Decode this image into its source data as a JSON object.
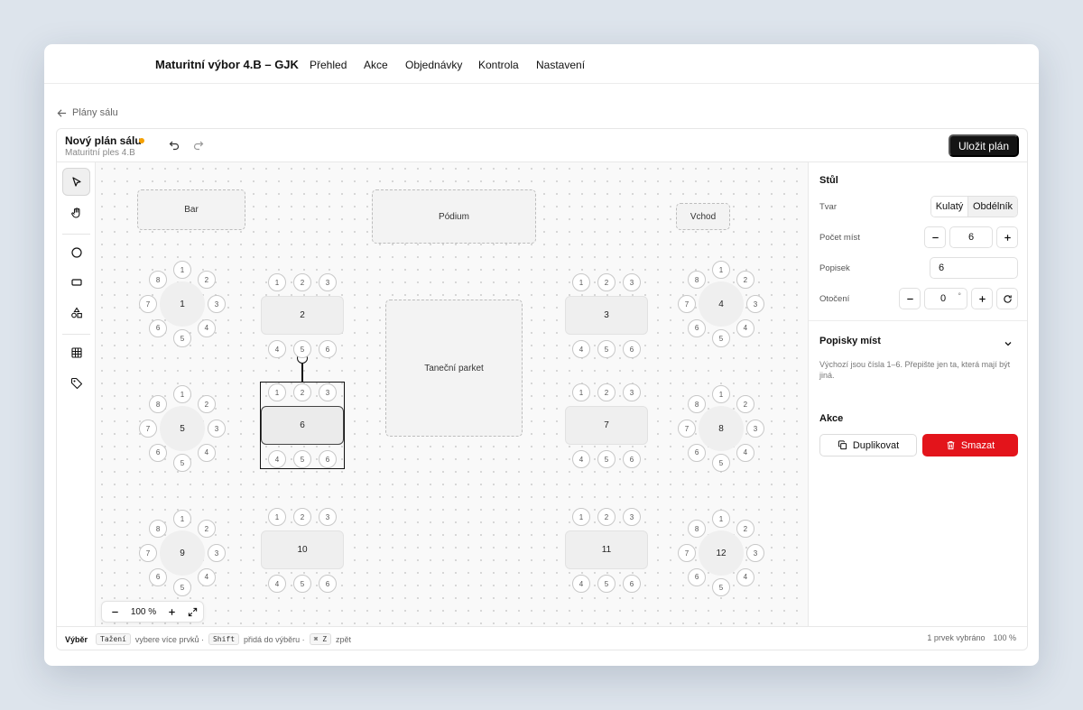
{
  "nav": {
    "brand": "Maturitní výbor 4.B – GJK",
    "links": [
      "Přehled",
      "Akce",
      "Objednávky",
      "Kontrola",
      "Nastavení"
    ]
  },
  "back": {
    "label": "Plány sálu"
  },
  "editor": {
    "title": "Nový plán sálu",
    "subtitle": "Maturitní ples 4.B",
    "save_label": "Uložit plán",
    "tools": [
      "select-tool",
      "hand-tool",
      "circle-tool",
      "rectangle-tool",
      "shapes-tool",
      "grid-tool",
      "tag-tool"
    ]
  },
  "canvas": {
    "zones": [
      {
        "id": "bar",
        "label": "Bar"
      },
      {
        "id": "podium",
        "label": "Pódium"
      },
      {
        "id": "vchod",
        "label": "Vchod"
      },
      {
        "id": "parket",
        "label": "Taneční parket"
      }
    ],
    "tables": [
      {
        "label": "1",
        "shape": "round",
        "seats": 8
      },
      {
        "label": "2",
        "shape": "rect",
        "seats": 6
      },
      {
        "label": "3",
        "shape": "rect",
        "seats": 6
      },
      {
        "label": "4",
        "shape": "round",
        "seats": 8
      },
      {
        "label": "5",
        "shape": "round",
        "seats": 8
      },
      {
        "label": "6",
        "shape": "rect",
        "seats": 6,
        "selected": true
      },
      {
        "label": "7",
        "shape": "rect",
        "seats": 6
      },
      {
        "label": "8",
        "shape": "round",
        "seats": 8
      },
      {
        "label": "9",
        "shape": "round",
        "seats": 8
      },
      {
        "label": "10",
        "shape": "rect",
        "seats": 6
      },
      {
        "label": "11",
        "shape": "rect",
        "seats": 6
      },
      {
        "label": "12",
        "shape": "round",
        "seats": 8
      }
    ],
    "zoom_label": "100 %"
  },
  "panel": {
    "table_heading": "Stůl",
    "shape_label": "Tvar",
    "shape_options": [
      "Kulatý",
      "Obdélník"
    ],
    "shape_selected": "Kulatý",
    "seats_label": "Počet míst",
    "seats_value": "6",
    "caption_label": "Popisek",
    "caption_value": "6",
    "rotation_label": "Otočení",
    "rotation_value": "0",
    "rotation_unit": "°",
    "seat_labels_heading": "Popisky míst",
    "seat_labels_hint": "Výchozí jsou čísla 1–6. Přepište jen ta, která mají být jiná.",
    "actions_heading": "Akce",
    "duplicate_label": "Duplikovat",
    "delete_label": "Smazat"
  },
  "status": {
    "mode": "Výběr",
    "key_drag": "Tažení",
    "text_drag": "vybere více prvků ·",
    "key_shift": "Shift",
    "text_shift": "přidá do výběru ·",
    "key_undo": "⌘ Z",
    "text_undo": "zpět",
    "selection": "1 prvek vybráno",
    "zoom": "100 %"
  },
  "colors": {
    "accent_unsaved": "#f5a000",
    "danger": "#e3141b",
    "primary": "#141414"
  }
}
